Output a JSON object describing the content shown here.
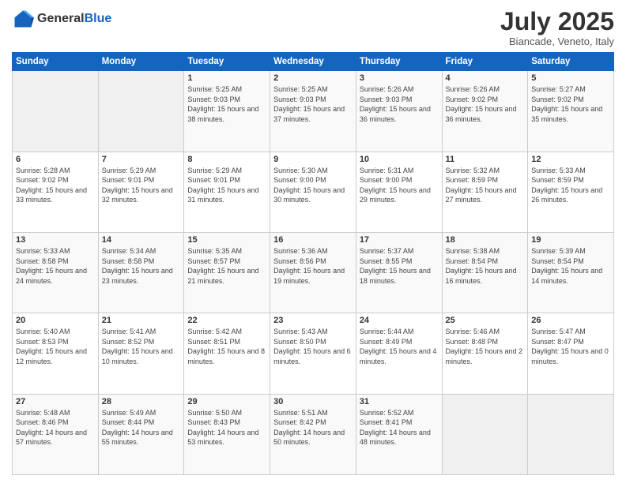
{
  "header": {
    "logo_general": "General",
    "logo_blue": "Blue",
    "month": "July 2025",
    "location": "Biancade, Veneto, Italy"
  },
  "weekdays": [
    "Sunday",
    "Monday",
    "Tuesday",
    "Wednesday",
    "Thursday",
    "Friday",
    "Saturday"
  ],
  "weeks": [
    [
      {
        "day": "",
        "sunrise": "",
        "sunset": "",
        "daylight": "",
        "empty": true
      },
      {
        "day": "",
        "sunrise": "",
        "sunset": "",
        "daylight": "",
        "empty": true
      },
      {
        "day": "1",
        "sunrise": "Sunrise: 5:25 AM",
        "sunset": "Sunset: 9:03 PM",
        "daylight": "Daylight: 15 hours and 38 minutes."
      },
      {
        "day": "2",
        "sunrise": "Sunrise: 5:25 AM",
        "sunset": "Sunset: 9:03 PM",
        "daylight": "Daylight: 15 hours and 37 minutes."
      },
      {
        "day": "3",
        "sunrise": "Sunrise: 5:26 AM",
        "sunset": "Sunset: 9:03 PM",
        "daylight": "Daylight: 15 hours and 36 minutes."
      },
      {
        "day": "4",
        "sunrise": "Sunrise: 5:26 AM",
        "sunset": "Sunset: 9:02 PM",
        "daylight": "Daylight: 15 hours and 36 minutes."
      },
      {
        "day": "5",
        "sunrise": "Sunrise: 5:27 AM",
        "sunset": "Sunset: 9:02 PM",
        "daylight": "Daylight: 15 hours and 35 minutes."
      }
    ],
    [
      {
        "day": "6",
        "sunrise": "Sunrise: 5:28 AM",
        "sunset": "Sunset: 9:02 PM",
        "daylight": "Daylight: 15 hours and 33 minutes."
      },
      {
        "day": "7",
        "sunrise": "Sunrise: 5:29 AM",
        "sunset": "Sunset: 9:01 PM",
        "daylight": "Daylight: 15 hours and 32 minutes."
      },
      {
        "day": "8",
        "sunrise": "Sunrise: 5:29 AM",
        "sunset": "Sunset: 9:01 PM",
        "daylight": "Daylight: 15 hours and 31 minutes."
      },
      {
        "day": "9",
        "sunrise": "Sunrise: 5:30 AM",
        "sunset": "Sunset: 9:00 PM",
        "daylight": "Daylight: 15 hours and 30 minutes."
      },
      {
        "day": "10",
        "sunrise": "Sunrise: 5:31 AM",
        "sunset": "Sunset: 9:00 PM",
        "daylight": "Daylight: 15 hours and 29 minutes."
      },
      {
        "day": "11",
        "sunrise": "Sunrise: 5:32 AM",
        "sunset": "Sunset: 8:59 PM",
        "daylight": "Daylight: 15 hours and 27 minutes."
      },
      {
        "day": "12",
        "sunrise": "Sunrise: 5:33 AM",
        "sunset": "Sunset: 8:59 PM",
        "daylight": "Daylight: 15 hours and 26 minutes."
      }
    ],
    [
      {
        "day": "13",
        "sunrise": "Sunrise: 5:33 AM",
        "sunset": "Sunset: 8:58 PM",
        "daylight": "Daylight: 15 hours and 24 minutes."
      },
      {
        "day": "14",
        "sunrise": "Sunrise: 5:34 AM",
        "sunset": "Sunset: 8:58 PM",
        "daylight": "Daylight: 15 hours and 23 minutes."
      },
      {
        "day": "15",
        "sunrise": "Sunrise: 5:35 AM",
        "sunset": "Sunset: 8:57 PM",
        "daylight": "Daylight: 15 hours and 21 minutes."
      },
      {
        "day": "16",
        "sunrise": "Sunrise: 5:36 AM",
        "sunset": "Sunset: 8:56 PM",
        "daylight": "Daylight: 15 hours and 19 minutes."
      },
      {
        "day": "17",
        "sunrise": "Sunrise: 5:37 AM",
        "sunset": "Sunset: 8:55 PM",
        "daylight": "Daylight: 15 hours and 18 minutes."
      },
      {
        "day": "18",
        "sunrise": "Sunrise: 5:38 AM",
        "sunset": "Sunset: 8:54 PM",
        "daylight": "Daylight: 15 hours and 16 minutes."
      },
      {
        "day": "19",
        "sunrise": "Sunrise: 5:39 AM",
        "sunset": "Sunset: 8:54 PM",
        "daylight": "Daylight: 15 hours and 14 minutes."
      }
    ],
    [
      {
        "day": "20",
        "sunrise": "Sunrise: 5:40 AM",
        "sunset": "Sunset: 8:53 PM",
        "daylight": "Daylight: 15 hours and 12 minutes."
      },
      {
        "day": "21",
        "sunrise": "Sunrise: 5:41 AM",
        "sunset": "Sunset: 8:52 PM",
        "daylight": "Daylight: 15 hours and 10 minutes."
      },
      {
        "day": "22",
        "sunrise": "Sunrise: 5:42 AM",
        "sunset": "Sunset: 8:51 PM",
        "daylight": "Daylight: 15 hours and 8 minutes."
      },
      {
        "day": "23",
        "sunrise": "Sunrise: 5:43 AM",
        "sunset": "Sunset: 8:50 PM",
        "daylight": "Daylight: 15 hours and 6 minutes."
      },
      {
        "day": "24",
        "sunrise": "Sunrise: 5:44 AM",
        "sunset": "Sunset: 8:49 PM",
        "daylight": "Daylight: 15 hours and 4 minutes."
      },
      {
        "day": "25",
        "sunrise": "Sunrise: 5:46 AM",
        "sunset": "Sunset: 8:48 PM",
        "daylight": "Daylight: 15 hours and 2 minutes."
      },
      {
        "day": "26",
        "sunrise": "Sunrise: 5:47 AM",
        "sunset": "Sunset: 8:47 PM",
        "daylight": "Daylight: 15 hours and 0 minutes."
      }
    ],
    [
      {
        "day": "27",
        "sunrise": "Sunrise: 5:48 AM",
        "sunset": "Sunset: 8:46 PM",
        "daylight": "Daylight: 14 hours and 57 minutes."
      },
      {
        "day": "28",
        "sunrise": "Sunrise: 5:49 AM",
        "sunset": "Sunset: 8:44 PM",
        "daylight": "Daylight: 14 hours and 55 minutes."
      },
      {
        "day": "29",
        "sunrise": "Sunrise: 5:50 AM",
        "sunset": "Sunset: 8:43 PM",
        "daylight": "Daylight: 14 hours and 53 minutes."
      },
      {
        "day": "30",
        "sunrise": "Sunrise: 5:51 AM",
        "sunset": "Sunset: 8:42 PM",
        "daylight": "Daylight: 14 hours and 50 minutes."
      },
      {
        "day": "31",
        "sunrise": "Sunrise: 5:52 AM",
        "sunset": "Sunset: 8:41 PM",
        "daylight": "Daylight: 14 hours and 48 minutes."
      },
      {
        "day": "",
        "sunrise": "",
        "sunset": "",
        "daylight": "",
        "empty": true
      },
      {
        "day": "",
        "sunrise": "",
        "sunset": "",
        "daylight": "",
        "empty": true
      }
    ]
  ]
}
